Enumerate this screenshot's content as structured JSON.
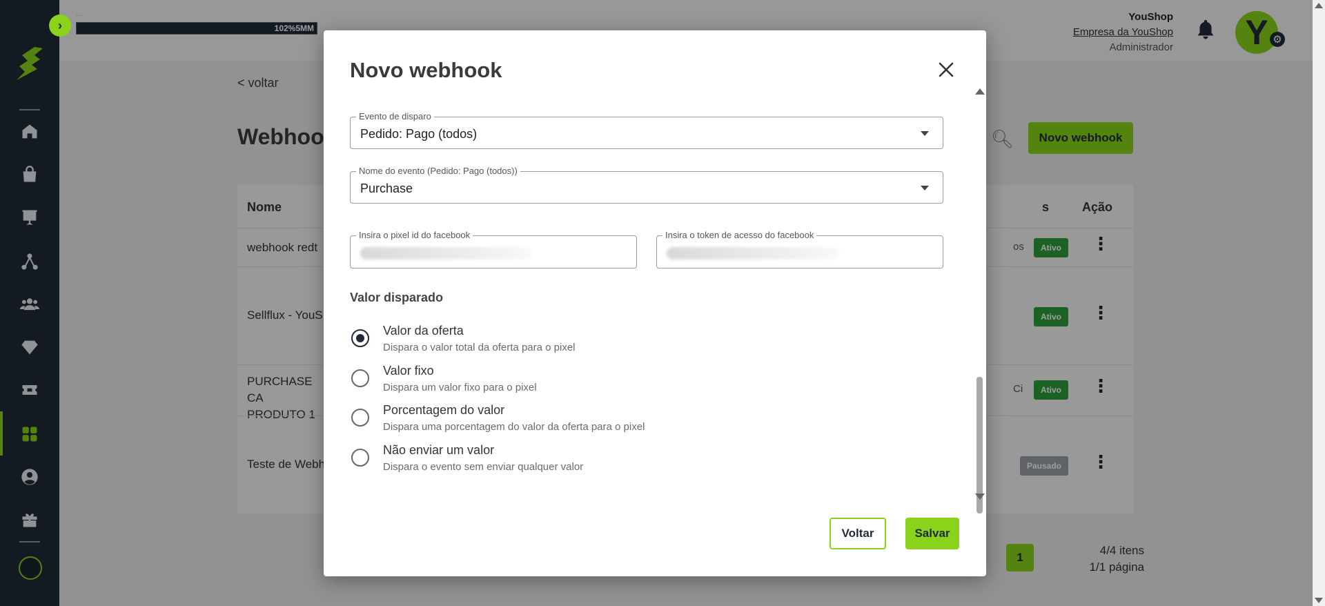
{
  "topbar": {
    "progress_caption": "...",
    "progress_label": "102%5MM",
    "user_name": "YouShop",
    "company": "Empresa da YouShop",
    "role": "Administrador",
    "avatar_letter": "Y"
  },
  "page": {
    "back_link": "< voltar",
    "title": "Webhooks",
    "new_button": "Novo webhook",
    "columns": {
      "name": "Nome",
      "status": "s",
      "action": "Ação"
    },
    "rows": [
      {
        "name": "webhook redt",
        "extra": "os",
        "status": "Ativo"
      },
      {
        "name": "Sellflux - YouS",
        "extra": "",
        "status": "Ativo"
      },
      {
        "name": "PURCHASE CA PRODUTO 1",
        "extra": "Ci",
        "status": "Ativo"
      },
      {
        "name": "Teste de Webh",
        "extra": "",
        "status": "Pausado"
      }
    ],
    "pager": {
      "current": "1",
      "items": "4/4 itens",
      "pages": "1/1 página"
    }
  },
  "modal": {
    "title": "Novo webhook",
    "trigger_event": {
      "label": "Evento de disparo",
      "value": "Pedido: Pago (todos)"
    },
    "event_name": {
      "label": "Nome do evento (Pedido: Pago (todos))",
      "value": "Purchase"
    },
    "pixel_id": {
      "label": "Insira o pixel id do facebook"
    },
    "access_token": {
      "label": "Insira o token de acesso do facebook"
    },
    "value_section": "Valor disparado",
    "options": [
      {
        "title": "Valor da oferta",
        "desc": "Dispara o valor total da oferta para o pixel",
        "checked": true
      },
      {
        "title": "Valor fixo",
        "desc": "Dispara um valor fixo para o pixel",
        "checked": false
      },
      {
        "title": "Porcentagem do valor",
        "desc": "Dispara uma porcentagem do valor da oferta para o pixel",
        "checked": false
      },
      {
        "title": "Não enviar um valor",
        "desc": "Dispara o evento sem enviar qualquer valor",
        "checked": false
      }
    ],
    "back_button": "Voltar",
    "save_button": "Salvar"
  },
  "colors": {
    "accent": "#8ad31a",
    "sidebar": "#1f2a38",
    "badge_active": "#2e9e3b",
    "badge_paused": "#9aa0a6"
  },
  "icons": {
    "sidebar": [
      "home-icon",
      "bag-icon",
      "presentation-icon",
      "network-icon",
      "users-icon",
      "diamond-icon",
      "ticket-icon",
      "grid-icon",
      "user-circle-icon",
      "gift-icon"
    ]
  }
}
